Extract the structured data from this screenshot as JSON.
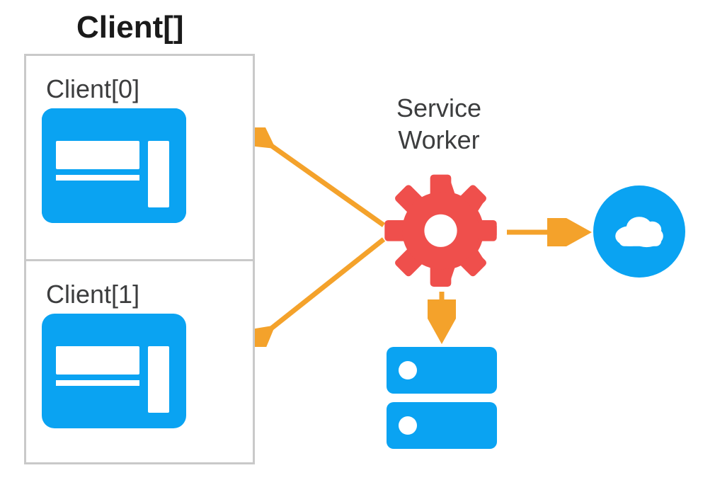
{
  "title": "Client[]",
  "clients": [
    {
      "label": "Client[0]"
    },
    {
      "label": "Client[1]"
    }
  ],
  "service_worker": {
    "label_line1": "Service",
    "label_line2": "Worker"
  },
  "colors": {
    "blue": "#0aa3f2",
    "red": "#ef4f4c",
    "orange": "#f4a22b",
    "gray_border": "#c9c9c9",
    "text": "#3c3d3e"
  },
  "nodes": [
    "client-array",
    "client-0",
    "client-1",
    "service-worker",
    "server",
    "cloud"
  ],
  "edges": [
    {
      "from": "service-worker",
      "to": "client-0",
      "bidirectional": false
    },
    {
      "from": "service-worker",
      "to": "client-1",
      "bidirectional": false
    },
    {
      "from": "service-worker",
      "to": "server",
      "bidirectional": false
    },
    {
      "from": "service-worker",
      "to": "cloud",
      "bidirectional": false
    }
  ]
}
